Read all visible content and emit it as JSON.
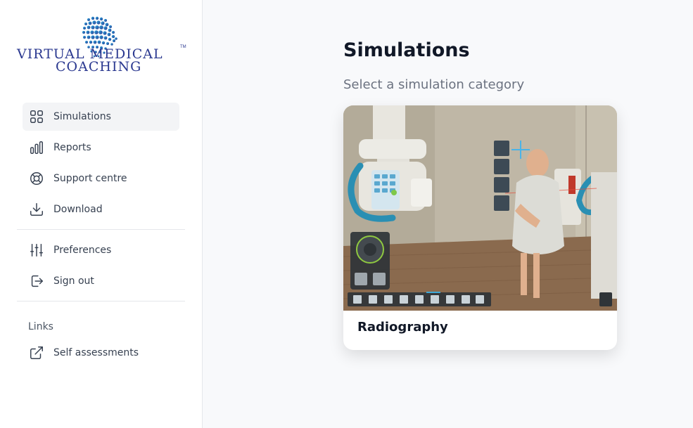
{
  "brand": {
    "line1": "VIRTUAL MEDICAL",
    "line2": "COACHING",
    "trademark": "TM"
  },
  "sidebar": {
    "items": [
      {
        "label": "Simulations",
        "icon": "grid-icon",
        "active": true
      },
      {
        "label": "Reports",
        "icon": "bar-chart-icon"
      },
      {
        "label": "Support centre",
        "icon": "lifebuoy-icon"
      },
      {
        "label": "Download",
        "icon": "download-icon"
      }
    ],
    "secondary": [
      {
        "label": "Preferences",
        "icon": "sliders-icon"
      },
      {
        "label": "Sign out",
        "icon": "sign-out-icon"
      }
    ],
    "links_heading": "Links",
    "links": [
      {
        "label": "Self assessments",
        "icon": "external-link-icon"
      }
    ]
  },
  "main": {
    "title": "Simulations",
    "subtitle": "Select a simulation category",
    "cards": [
      {
        "label": "Radiography",
        "image": "radiography-simulation-scene"
      }
    ]
  }
}
